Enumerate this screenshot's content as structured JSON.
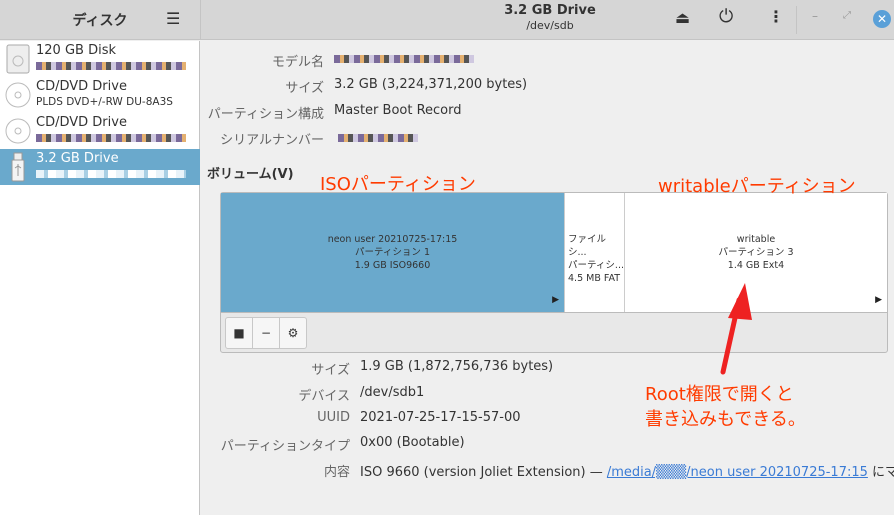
{
  "sidebar": {
    "title": "ディスク",
    "disks": [
      {
        "name": "120 GB Disk",
        "sub": ""
      },
      {
        "name": "CD/DVD Drive",
        "sub": "PLDS DVD+/-RW DU-8A3S"
      },
      {
        "name": "CD/DVD Drive",
        "sub": ""
      },
      {
        "name": "3.2 GB Drive",
        "sub": "",
        "selected": true
      }
    ]
  },
  "header": {
    "title": "3.2 GB Drive",
    "subtitle": "/dev/sdb"
  },
  "drive_info": [
    {
      "label": "モデル名",
      "value": ""
    },
    {
      "label": "サイズ",
      "value": "3.2 GB (3,224,371,200 bytes)"
    },
    {
      "label": "パーティション構成",
      "value": "Master Boot Record"
    },
    {
      "label": "シリアルナンバー",
      "value": ""
    }
  ],
  "volumes_label": "ボリューム(V)",
  "partitions": [
    {
      "l1": "neon user 20210725-17:15",
      "l2": "パーティション 1",
      "l3": "1.9 GB ISO9660"
    },
    {
      "l1": "ファイルシ...",
      "l2": "パーティシ...",
      "l3": "4.5 MB FAT"
    },
    {
      "l1": "writable",
      "l2": "パーティション 3",
      "l3": "1.4 GB Ext4"
    }
  ],
  "partition_info": [
    {
      "label": "サイズ",
      "value": "1.9 GB (1,872,756,736 bytes)"
    },
    {
      "label": "デバイス",
      "value": "/dev/sdb1"
    },
    {
      "label": "UUID",
      "value": "2021-07-25-17-15-57-00"
    },
    {
      "label": "パーティションタイプ",
      "value": "0x00 (Bootable)"
    },
    {
      "label": "内容",
      "value": "ISO 9660 (version Joliet Extension) — ",
      "link": "/media/▒▒▒/neon user 20210725-17:15",
      "suffix": " にマウ..."
    }
  ],
  "annotations": {
    "iso": "ISOパーティション",
    "writable": "writableパーティション",
    "note1": "Root権限で開くと",
    "note2": "書き込みもできる。"
  },
  "colors": {
    "selection": "#6aa9cc",
    "annotation": "#ff3b00"
  }
}
